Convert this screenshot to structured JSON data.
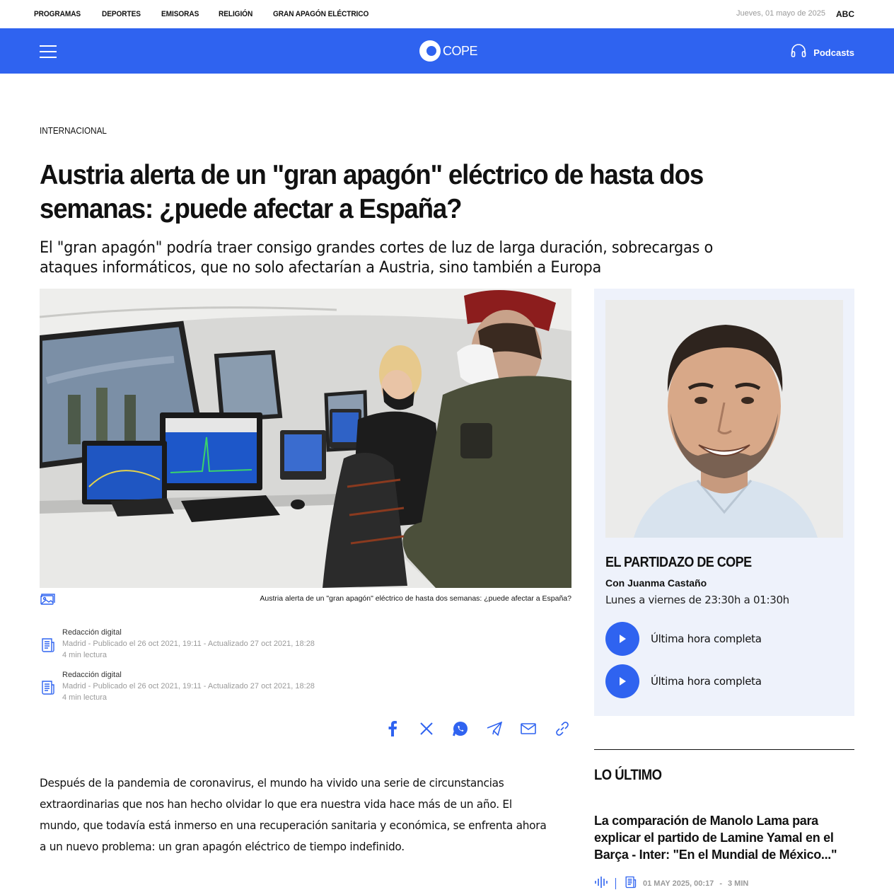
{
  "topnav": {
    "items": [
      "PROGRAMAS",
      "DEPORTES",
      "EMISORAS",
      "RELIGIÓN",
      "GRAN APAGÓN ELÉCTRICO"
    ],
    "date": "Jueves, 01 mayo de 2025",
    "abc": "ABC"
  },
  "header": {
    "logo_text": "COPE",
    "podcasts_label": "Podcasts",
    "brand_color": "#2f63f0"
  },
  "article": {
    "section": "INTERNACIONAL",
    "headline": "Austria alerta de un \"gran apagón\" eléctrico de hasta dos semanas: ¿puede afectar a España?",
    "subheadline": "El \"gran apagón\" podría traer consigo grandes cortes de luz de larga duración, sobrecargas o ataques informáticos, que no solo afectarían a Austria, sino también a Europa",
    "image_caption": "Austria alerta de un \"gran apagón\" eléctrico de hasta dos semanas: ¿puede afectar a España?",
    "bylines": [
      {
        "author": "Redacción digital",
        "meta": "Madrid - Publicado el 26 oct 2021, 19:11 - Actualizado 27 oct 2021, 18:28",
        "reading": "4 min lectura"
      },
      {
        "author": "Redacción digital",
        "meta": "Madrid - Publicado el 26 oct 2021, 19:11 - Actualizado 27 oct 2021, 18:28",
        "reading": "4 min lectura"
      }
    ],
    "share": [
      "facebook-icon",
      "x-icon",
      "whatsapp-icon",
      "telegram-icon",
      "mail-icon",
      "link-icon"
    ],
    "body": "Después de la pandemia de coronavirus, el mundo ha vivido una serie de circunstancias extraordinarias que nos han hecho olvidar lo que era nuestra vida hace más de un año. El mundo, que todavía está inmerso en una recuperación sanitaria y económica, se enfrenta ahora a un nuevo problema: un gran apagón eléctrico de tiempo indefinido."
  },
  "radio": {
    "program": "EL PARTIDAZO DE COPE",
    "host": "Con Juanma Castaño",
    "schedule": "Lunes a viernes de 23:30h a 01:30h",
    "play_items": [
      "Última hora completa",
      "Última hora completa"
    ]
  },
  "latest": {
    "title": "LO ÚLTIMO",
    "item_title": "La comparación de Manolo Lama para explicar el partido de Lamine Yamal en el Barça - Inter: \"En el Mundial de México...\"",
    "item_date": "01 MAY 2025, 00:17",
    "item_dash": "-",
    "item_duration": "3 MIN"
  }
}
